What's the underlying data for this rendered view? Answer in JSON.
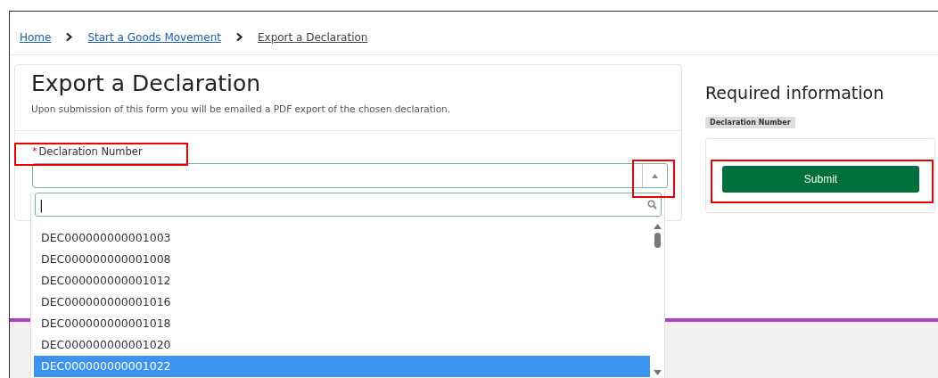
{
  "breadcrumb": [
    {
      "label": "Home",
      "current": false
    },
    {
      "label": "Start a Goods Movement",
      "current": false
    },
    {
      "label": "Export a Declaration",
      "current": true
    }
  ],
  "form": {
    "title": "Export a Declaration",
    "description": "Upon submission of this form you will be emailed a PDF export of the chosen declaration.",
    "field_label": "Declaration Number",
    "required_mark": "*",
    "search_value": "|",
    "options": [
      {
        "label": "DEC000000000001003",
        "selected": false
      },
      {
        "label": "DEC000000000001008",
        "selected": false
      },
      {
        "label": "DEC000000000001012",
        "selected": false
      },
      {
        "label": "DEC000000000001016",
        "selected": false
      },
      {
        "label": "DEC000000000001018",
        "selected": false
      },
      {
        "label": "DEC000000000001020",
        "selected": false
      },
      {
        "label": "DEC000000000001022",
        "selected": true
      }
    ]
  },
  "sidebar": {
    "title": "Required information",
    "tags": [
      "Declaration Number"
    ],
    "submit": "Submit"
  }
}
